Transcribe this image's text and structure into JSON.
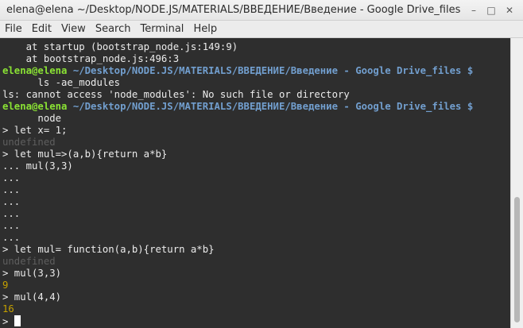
{
  "window": {
    "title": "elena@elena ~/Desktop/NODE.JS/MATERIALS/ВВЕДЕНИЕ/Введение - Google Drive_files",
    "controls": {
      "minimize": "–",
      "maximize": "□",
      "close": "✕"
    }
  },
  "menu": [
    "File",
    "Edit",
    "View",
    "Search",
    "Terminal",
    "Help"
  ],
  "terminal": {
    "lines": [
      {
        "text": "    at startup (bootstrap_node.js:149:9)"
      },
      {
        "text": "    at bootstrap_node.js:496:3"
      },
      {
        "user": "elena@elena",
        "path": " ~/Desktop/NODE.JS/MATERIALS/ВВЕДЕНИЕ/Введение - Google Drive_files $"
      },
      {
        "text": "      ls -ae_modules"
      },
      {
        "text": "ls: cannot access 'node_modules': No such file or directory"
      },
      {
        "user": "elena@elena",
        "path": " ~/Desktop/NODE.JS/MATERIALS/ВВЕДЕНИЕ/Введение - Google Drive_files $"
      },
      {
        "text": "      node"
      },
      {
        "text": "> let x= 1;"
      },
      {
        "text": "undefined",
        "style": "dim"
      },
      {
        "text": "> let mul=>(a,b){return a*b}"
      },
      {
        "text": "... mul(3,3)"
      },
      {
        "text": "..."
      },
      {
        "text": "..."
      },
      {
        "text": "..."
      },
      {
        "text": "..."
      },
      {
        "text": "..."
      },
      {
        "text": "..."
      },
      {
        "text": "> let mul= function(a,b){return a*b}"
      },
      {
        "text": "undefined",
        "style": "dim"
      },
      {
        "text": "> mul(3,3)"
      },
      {
        "text": "9",
        "style": "num"
      },
      {
        "text": "> mul(4,4)"
      },
      {
        "text": "16",
        "style": "num"
      },
      {
        "text": "> ",
        "cursor": true
      }
    ]
  },
  "colors": {
    "prompt_user": "#8ae234",
    "prompt_path": "#729fcf",
    "result_number": "#c4a000",
    "undefined_text": "#5e5e5e",
    "background": "#2e2e2e"
  }
}
